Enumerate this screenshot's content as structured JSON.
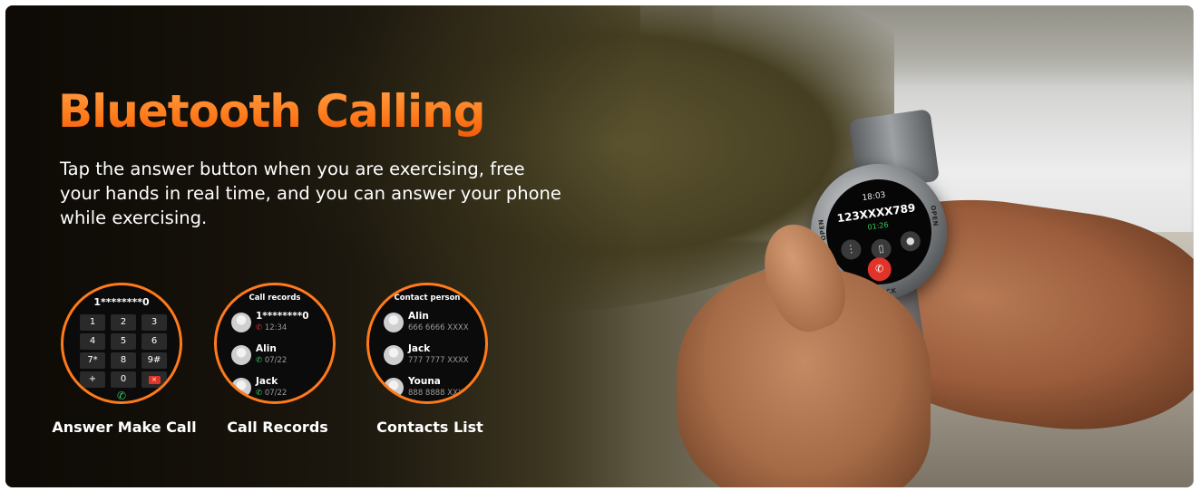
{
  "headline": "Bluetooth Calling",
  "description": "Tap the answer button when you are exercising, free your hands in real time, and you can answer your phone while exercising.",
  "colors": {
    "accent": "#ff7a1a",
    "hangup": "#e0342a",
    "answer": "#35d05a"
  },
  "watch": {
    "time": "18:03",
    "number": "123XXXX789",
    "duration": "01:26",
    "bezel_left": "OPEN",
    "bezel_bottom": "BACK",
    "bezel_right": "OPEN",
    "icons": [
      "keypad-icon",
      "phone-icon",
      "microphone-icon",
      "hang-up-icon"
    ]
  },
  "features": [
    {
      "label": "Answer Make Call",
      "screen": {
        "number": "1********0",
        "keys": [
          "1",
          "2",
          "3",
          "4",
          "5",
          "6",
          "7*",
          "8",
          "9#",
          "+",
          "0",
          "×"
        ]
      }
    },
    {
      "label": "Call Records",
      "screen": {
        "title": "Call records",
        "entries": [
          {
            "name": "1********0",
            "detail": "12:34",
            "type": "missed"
          },
          {
            "name": "Alin",
            "detail": "07/22",
            "type": "incoming"
          },
          {
            "name": "Jack",
            "detail": "07/22",
            "type": "incoming"
          }
        ]
      }
    },
    {
      "label": "Contacts List",
      "screen": {
        "title": "Contact person",
        "entries": [
          {
            "name": "Alin",
            "detail": "666 6666 XXXX"
          },
          {
            "name": "Jack",
            "detail": "777 7777 XXXX"
          },
          {
            "name": "Youna",
            "detail": "888 8888 XXXX"
          }
        ]
      }
    }
  ]
}
